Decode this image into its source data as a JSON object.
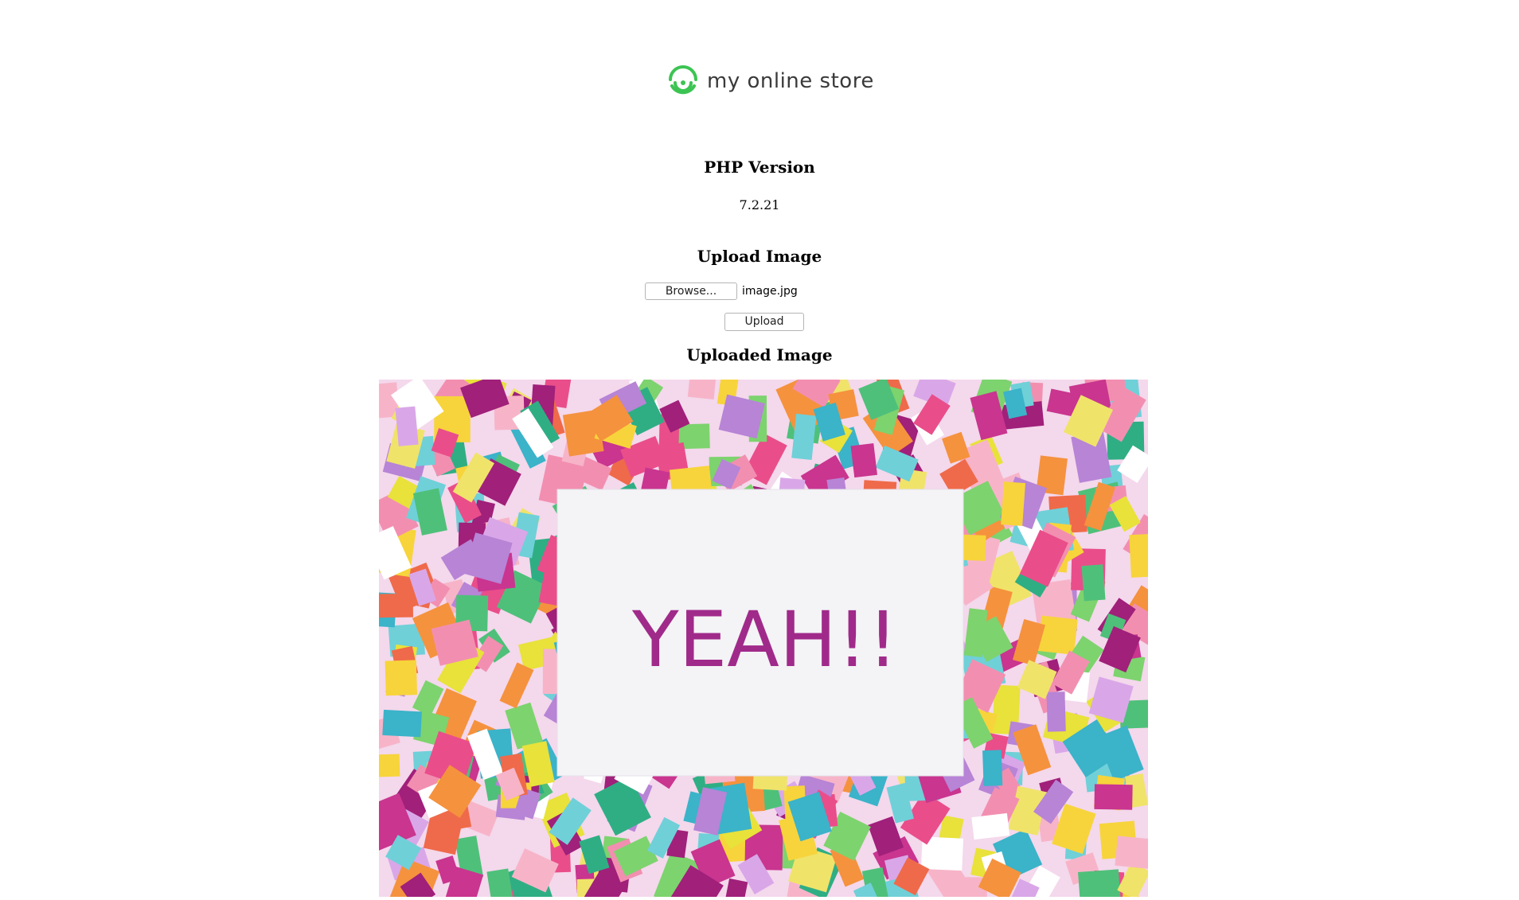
{
  "logo": {
    "text": "my online store",
    "icon": "store-logo-icon",
    "accent_color": "#3cc453"
  },
  "php_section": {
    "heading": "PHP Version",
    "version": "7.2.21"
  },
  "upload_section": {
    "heading": "Upload Image",
    "browse_label": "Browse...",
    "selected_file": "image.jpg",
    "upload_label": "Upload"
  },
  "uploaded_section": {
    "heading": "Uploaded Image",
    "card_text": "YEAH!!",
    "card_text_color": "#a02a8a"
  }
}
